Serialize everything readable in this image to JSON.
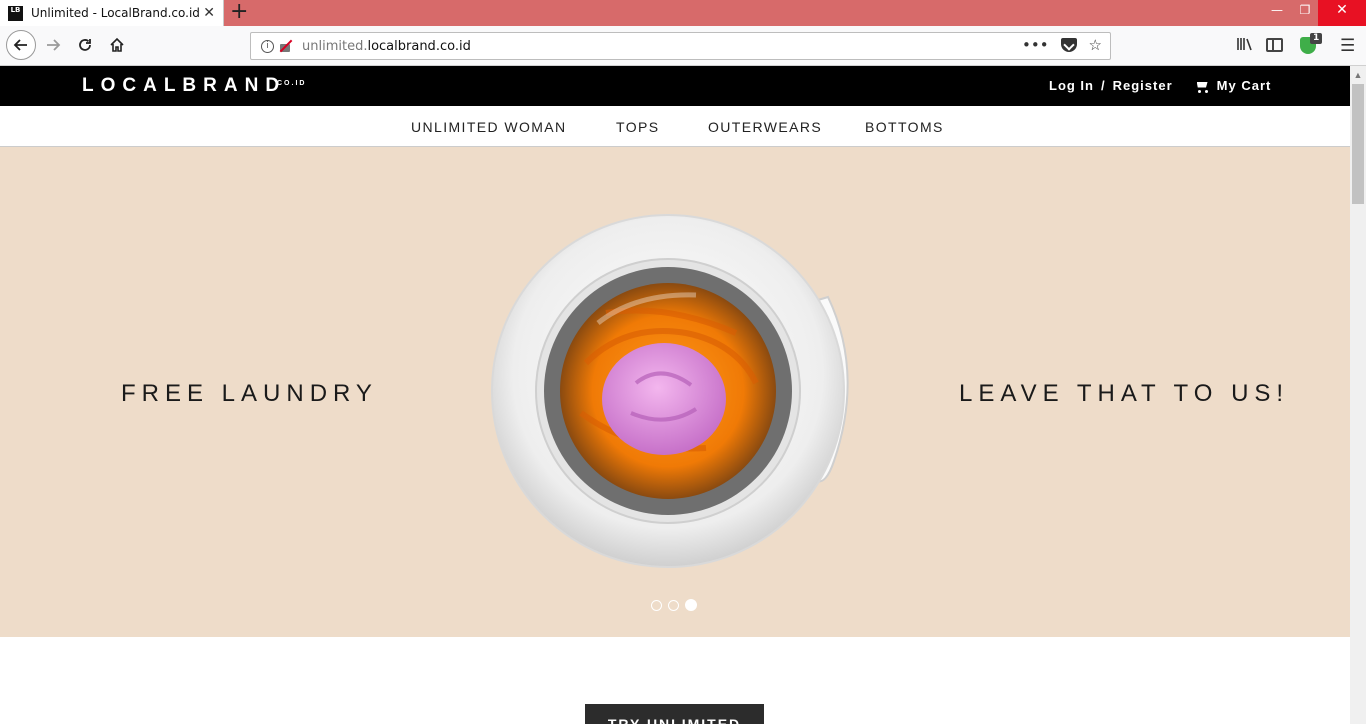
{
  "browser": {
    "tab_title": "Unlimited - LocalBrand.co.id",
    "tab_favicon_text": "LB",
    "tab_close": "✕",
    "new_tab": "+",
    "url_prefix": "unlimited.",
    "url_domain": "localbrand.co.id",
    "extension_badge": "1",
    "window_min": "—",
    "window_max": "❐",
    "window_close": "✕"
  },
  "site": {
    "logo": "LOCALBRAND",
    "logo_suffix": "CO.ID",
    "login_label": "Log In",
    "separator": "/",
    "register_label": "Register",
    "cart_label": "My Cart"
  },
  "nav": {
    "items": [
      "UNLIMITED WOMAN",
      "TOPS",
      "OUTERWEARS",
      "BOTTOMS"
    ]
  },
  "hero": {
    "left_text": "FREE LAUNDRY",
    "right_text": "LEAVE THAT TO US!",
    "slide_count": 3,
    "active_slide": 3
  },
  "cta": {
    "label": "TRY UNLIMITED"
  },
  "colors": {
    "browser_titlebar": "#d76a6a",
    "site_header": "#000000",
    "hero_bg": "#eedcc9",
    "cta_bg": "#2c2c2c"
  }
}
